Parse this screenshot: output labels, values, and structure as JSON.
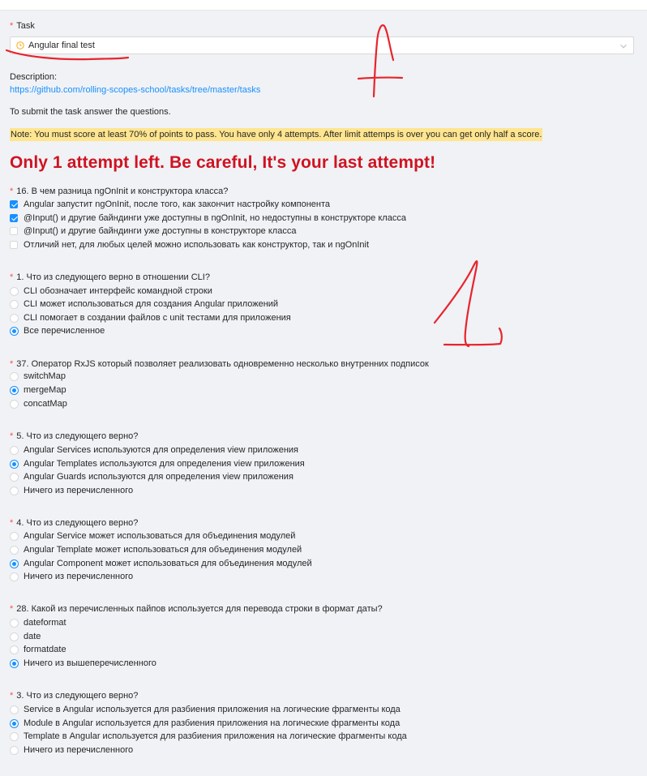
{
  "task": {
    "label": "Task",
    "required_mark": "*",
    "selected_value": "Angular final test"
  },
  "description": {
    "label": "Description:",
    "link": "https://github.com/rolling-scopes-school/tasks/tree/master/tasks"
  },
  "submit_text": "To submit the task answer the questions.",
  "note": "Note: You must score at least 70% of points to pass. You have only 4 attempts. After limit attemps is over you can get only half a score.",
  "warning": "Only 1 attempt left. Be careful, It's your last attempt!",
  "questions": [
    {
      "title": "16. В чем разница ngOnInit и конструктора класса?",
      "kind": "checkbox",
      "options": [
        {
          "text": "Angular запустит ngOnInit, после того, как закончит настройку компонента",
          "checked": true
        },
        {
          "text": "@Input() и другие байндинги уже доступны в ngOnInit, но недоступны в конструкторе класса",
          "checked": true
        },
        {
          "text": "@Input() и другие байндинги уже доступны в конструкторе класса",
          "checked": false
        },
        {
          "text": "Отличий нет, для любых целей можно использовать как конструктор, так и ngOnInit",
          "checked": false
        }
      ]
    },
    {
      "title": "1. Что из следующего верно в отношении CLI?",
      "kind": "radio",
      "options": [
        {
          "text": "CLI обозначает интерфейс командной строки",
          "checked": false
        },
        {
          "text": "CLI может использоваться для создания Angular приложений",
          "checked": false
        },
        {
          "text": "CLI помогает в создании файлов с unit тестами для приложения",
          "checked": false
        },
        {
          "text": "Все перечисленное",
          "checked": true
        }
      ]
    },
    {
      "title": "37. Оператор RxJS который позволяет реализовать одновременно несколько внутренних подписок",
      "kind": "radio",
      "options": [
        {
          "text": "switchMap",
          "checked": false
        },
        {
          "text": "mergeMap",
          "checked": true
        },
        {
          "text": "concatMap",
          "checked": false
        }
      ]
    },
    {
      "title": "5. Что из следующего верно?",
      "kind": "radio",
      "options": [
        {
          "text": "Angular Services используются для определения view приложения",
          "checked": false
        },
        {
          "text": "Angular Templates используются для определения view приложения",
          "checked": true
        },
        {
          "text": "Angular Guards используются для определения view приложения",
          "checked": false
        },
        {
          "text": "Ничего из перечисленного",
          "checked": false
        }
      ]
    },
    {
      "title": "4. Что из следующего верно?",
      "kind": "radio",
      "options": [
        {
          "text": "Angular Service может использоваться для объединения модулей",
          "checked": false
        },
        {
          "text": "Angular Template может использоваться для объединения модулей",
          "checked": false
        },
        {
          "text": "Angular Component может использоваться для объединения модулей",
          "checked": true
        },
        {
          "text": "Ничего из перечисленного",
          "checked": false
        }
      ]
    },
    {
      "title": "28. Какой из перечисленных пайпов используется для перевода строки в формат даты?",
      "kind": "radio",
      "options": [
        {
          "text": "dateformat",
          "checked": false
        },
        {
          "text": "date",
          "checked": false
        },
        {
          "text": "formatdate",
          "checked": false
        },
        {
          "text": "Ничего из вышеперечисленного",
          "checked": true
        }
      ]
    },
    {
      "title": "3. Что из следующего верно?",
      "kind": "radio",
      "options": [
        {
          "text": "Service в Angular используется для разбиения приложения на логические фрагменты кода",
          "checked": false
        },
        {
          "text": "Module в Angular используется для разбиения приложения на логические фрагменты кода",
          "checked": true
        },
        {
          "text": "Template в Angular используется для разбиения приложения на логические фрагменты кода",
          "checked": false
        },
        {
          "text": "Ничего из перечисленного",
          "checked": false
        }
      ]
    }
  ],
  "colors": {
    "accent": "#1890ff",
    "required": "#ff4d4f",
    "warning": "#cf1322",
    "note_bg": "#ffe58f",
    "annotation": "#e8242c"
  }
}
